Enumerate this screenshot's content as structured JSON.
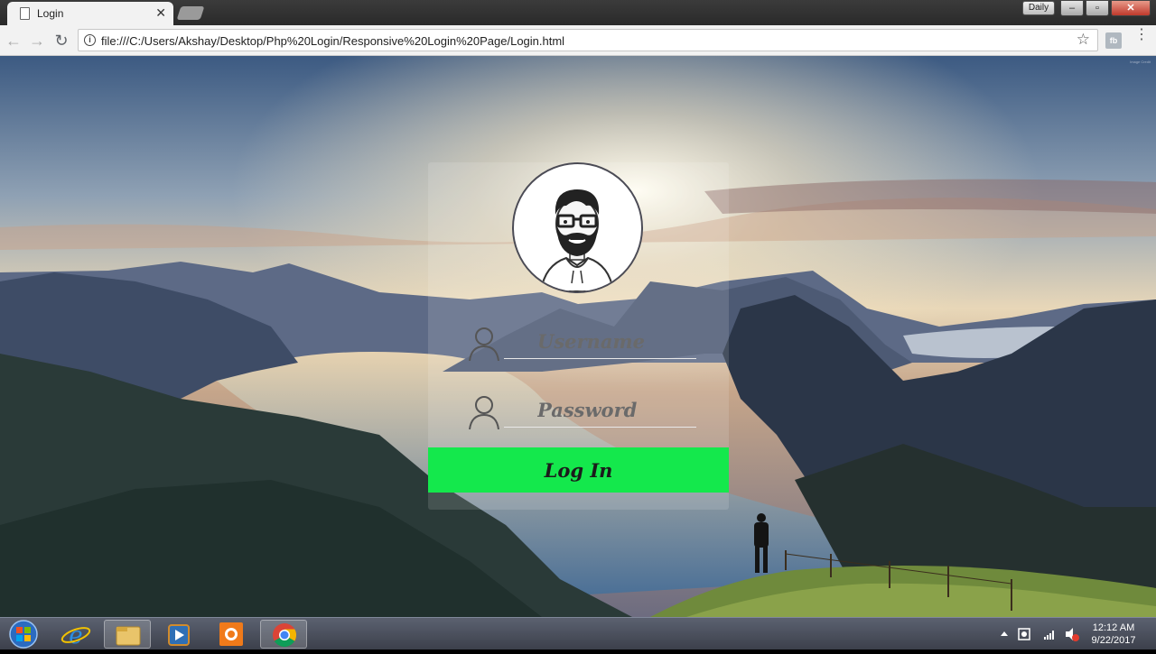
{
  "browser": {
    "tab_title": "Login",
    "tab_close": "✕",
    "url": "file:///C:/Users/Akshay/Desktop/Php%20Login/Responsive%20Login%20Page/Login.html",
    "daily_label": "Daily",
    "back": "←",
    "forward": "→",
    "reload": "↻",
    "star": "☆",
    "info": "i",
    "ext": "fb",
    "menu": "⋮"
  },
  "login": {
    "username_placeholder": "Username",
    "password_placeholder": "Password",
    "button_label": "Log In",
    "button_color": "#14e84c"
  },
  "taskbar": {
    "time": "12:12 AM",
    "date": "9/22/2017"
  },
  "icons": [
    "back-arrow-icon",
    "forward-arrow-icon",
    "reload-icon",
    "info-icon",
    "star-icon",
    "user-icon",
    "lock-user-icon",
    "windows-start-icon",
    "ie-icon",
    "explorer-icon",
    "media-icon",
    "app-icon",
    "chrome-icon"
  ]
}
